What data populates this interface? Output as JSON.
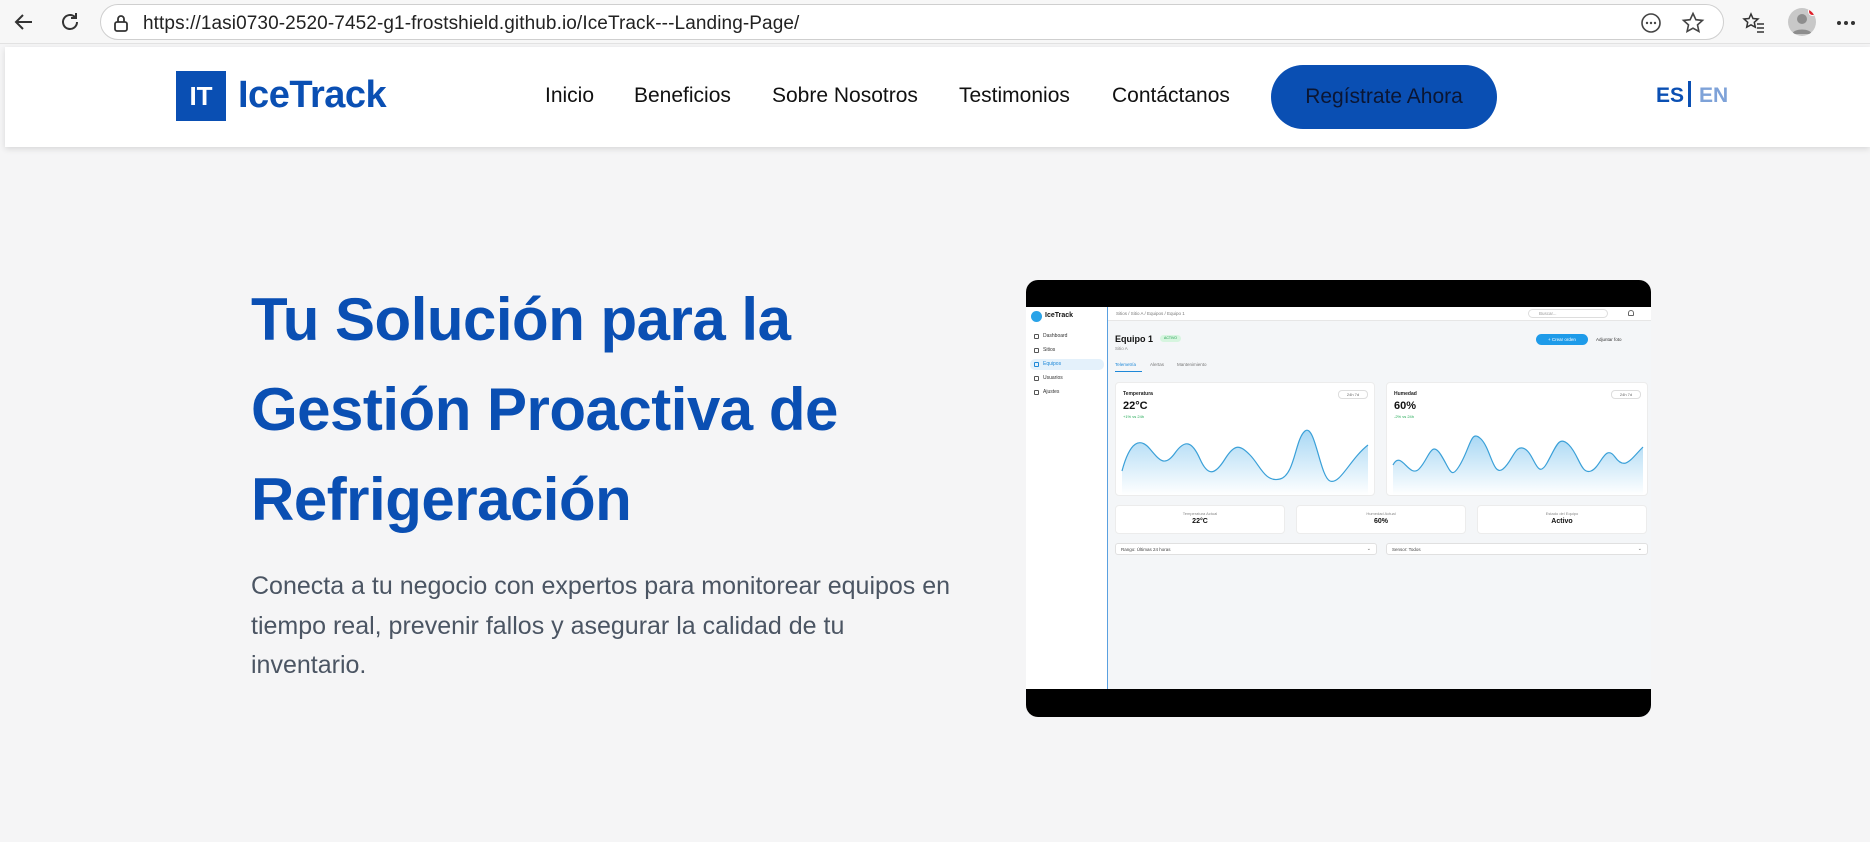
{
  "browser": {
    "url": "https://1asi0730-2520-7452-g1-frostshield.github.io/IceTrack---Landing-Page/"
  },
  "header": {
    "logo_mark": "IT",
    "logo_text": "IceTrack",
    "nav": [
      "Inicio",
      "Beneficios",
      "Sobre Nosotros",
      "Testimonios",
      "Contáctanos"
    ],
    "cta_label": "Regístrate Ahora",
    "lang_es": "ES",
    "lang_separator": "|",
    "lang_en": "EN"
  },
  "hero": {
    "title_lines": [
      "Tu Solución para la",
      "Gestión Proactiva de",
      "Refrigeración"
    ],
    "subtitle_lines": [
      "Conecta a tu negocio con expertos para monitorear equipos en",
      "tiempo real, prevenir fallos y asegurar la calidad de tu",
      "inventario."
    ]
  },
  "mock": {
    "app_name": "IceTrack",
    "sidebar": [
      "Dashboard",
      "Sitios",
      "Equipos",
      "Usuarios",
      "Ajustes"
    ],
    "sidebar_active": 2,
    "breadcrumb": "Sitios  /  Sitio A  /  Equipos  /  Equipo 1",
    "search_placeholder": "Buscar...",
    "title": "Equipo 1",
    "badge": "ACTIVO",
    "subtitle": "Sitio A",
    "primary_btn": "+ Crear orden",
    "secondary_btn": "Adjuntar foto",
    "tabs": [
      "Telemetría",
      "Alertas",
      "Mantenimiento"
    ],
    "cards": [
      {
        "title": "Temperatura",
        "value": "22°C",
        "delta": "+1% vs 24h",
        "segment": "24h   7d"
      },
      {
        "title": "Humedad",
        "value": "60%",
        "delta": "-2% vs 24h",
        "segment": "24h   7d"
      }
    ],
    "stats": [
      {
        "label": "Temperatura Actual",
        "value": "22°C"
      },
      {
        "label": "Humedad Actual",
        "value": "60%"
      },
      {
        "label": "Estado del Equipo",
        "value": "Activo"
      }
    ],
    "selects": [
      "Rango: Últimas 24 horas",
      "Sensor: Todos"
    ],
    "colors": {
      "accent": "#1e9be9",
      "line": "#3aa0d8"
    }
  },
  "colors": {
    "brand": "#0a4fb3",
    "lang_inactive": "#7ea2d8",
    "text_muted": "#4b5563",
    "page_bg": "#f5f5f6"
  }
}
